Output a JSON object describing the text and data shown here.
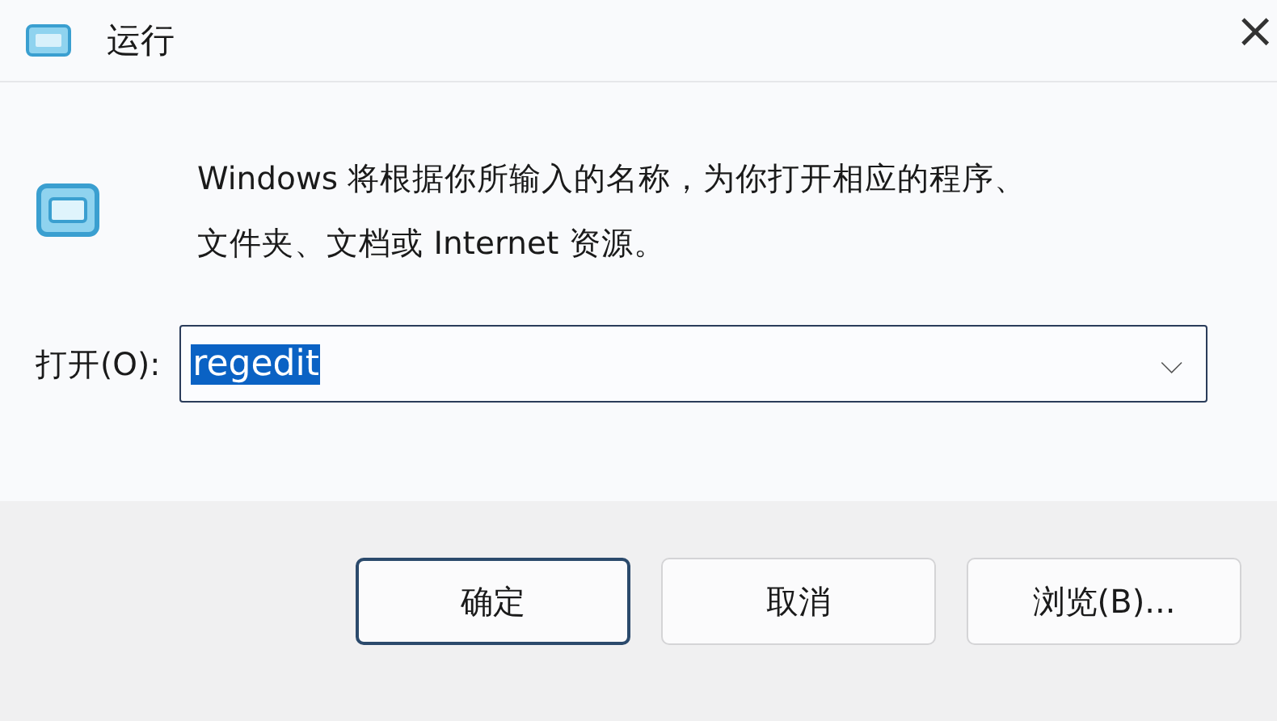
{
  "window": {
    "title": "运行",
    "close": "×"
  },
  "description": [
    "Windows 将根据你所输入的名称，为你打开相应的程序、",
    "文件夹、文档或 Internet 资源。"
  ],
  "open_field": {
    "label": "打开(O):",
    "value": "regedit",
    "value_selected": true,
    "dropdown": "⌵"
  },
  "buttons": [
    {
      "label": "确定",
      "default": true
    },
    {
      "label": "取消",
      "default": false
    },
    {
      "label": "浏览(B)...",
      "default": false
    }
  ]
}
